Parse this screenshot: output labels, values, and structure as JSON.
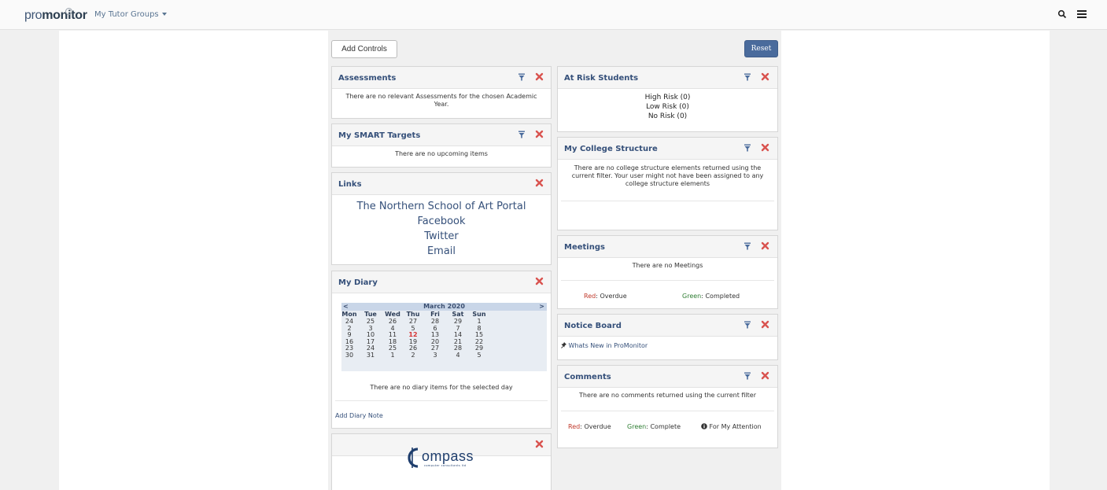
{
  "header": {
    "logo_pro": "pro",
    "logo_mon": "mon",
    "logo_itor": "itor",
    "groups_label": "My Tutor Groups"
  },
  "toolbar": {
    "add_label": "Add Controls",
    "reset_label": "Reset"
  },
  "assessments": {
    "title": "Assessments",
    "message": "There are no relevant Assessments for the chosen Academic Year."
  },
  "smart": {
    "title": "My SMART Targets",
    "message": "There are no upcoming items"
  },
  "links": {
    "title": "Links",
    "items": [
      "The Northern School of Art Portal",
      "Facebook",
      "Twitter",
      "Email"
    ]
  },
  "diary": {
    "title": "My Diary",
    "prev": "<",
    "next": ">",
    "month": "March 2020",
    "days": [
      "Mon",
      "Tue",
      "Wed",
      "Thu",
      "Fri",
      "Sat",
      "Sun"
    ],
    "weeks": [
      [
        "24",
        "25",
        "26",
        "27",
        "28",
        "29",
        "1"
      ],
      [
        "2",
        "3",
        "4",
        "5",
        "6",
        "7",
        "8"
      ],
      [
        "9",
        "10",
        "11",
        "12",
        "13",
        "14",
        "15"
      ],
      [
        "16",
        "17",
        "18",
        "19",
        "20",
        "21",
        "22"
      ],
      [
        "23",
        "24",
        "25",
        "26",
        "27",
        "28",
        "29"
      ],
      [
        "30",
        "31",
        "1",
        "2",
        "3",
        "4",
        "5"
      ]
    ],
    "today": "12",
    "message": "There are no diary items for the selected day",
    "add_note": "Add Diary Note"
  },
  "compass": {
    "logo_text": "ompass",
    "logo_sub": "computer consultants ltd"
  },
  "risk": {
    "title": "At Risk Students",
    "high": "High Risk (0)",
    "low": "Low Risk (0)",
    "none": "No Risk (0)"
  },
  "college": {
    "title": "My College Structure",
    "message": "There are no college structure elements returned using the current filter. Your user might not have been assigned to any college structure elements"
  },
  "meetings": {
    "title": "Meetings",
    "message": "There are no Meetings",
    "red_label": "Red",
    "red_text": ": Overdue",
    "green_label": "Green",
    "green_text": ": Completed"
  },
  "notice": {
    "title": "Notice Board",
    "item": "Whats New in ProMonitor"
  },
  "comments": {
    "title": "Comments",
    "message": "There are no comments returned using the current filter",
    "red_label": "Red",
    "red_text": ": Overdue",
    "green_label": "Green",
    "green_text": ": Complete",
    "attention": "For My Attention"
  },
  "colors": {
    "accent": "#35507a",
    "reset_button": "#4a6b9c",
    "close_red": "#d9534f",
    "today_red": "#d63333"
  }
}
